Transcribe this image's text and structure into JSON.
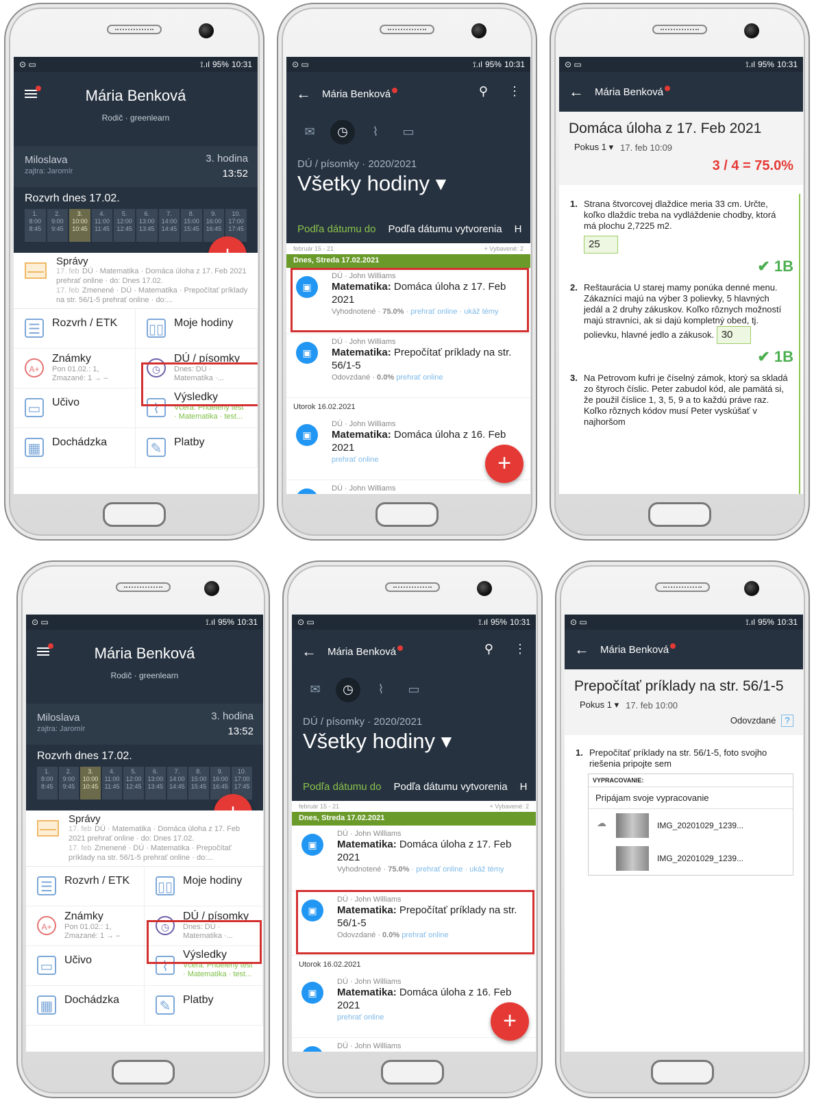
{
  "status_bar": {
    "signal": "⟟.ıl",
    "battery": "95%",
    "time": "10:31"
  },
  "home": {
    "title": "Mária Benková",
    "subtitle": "Rodič · greenlearn",
    "student": "Miloslava",
    "tomorrow": "zajtra: Jaromír",
    "lesson": "3. hodina",
    "lesson_time": "13:52",
    "schedule_title": "Rozvrh dnes 17.02.",
    "periods": [
      {
        "n": "1.",
        "t": "8:00 8:45"
      },
      {
        "n": "2.",
        "t": "9:00 9:45"
      },
      {
        "n": "3.",
        "t": "10:00 10:45"
      },
      {
        "n": "4.",
        "t": "11:00 11:45"
      },
      {
        "n": "5.",
        "t": "12:00 12:45"
      },
      {
        "n": "6.",
        "t": "13:00 13:45"
      },
      {
        "n": "7.",
        "t": "14:00 14:45"
      },
      {
        "n": "8.",
        "t": "15:00 15:45"
      },
      {
        "n": "9.",
        "t": "16:00 16:45"
      },
      {
        "n": "10.",
        "t": "17:00 17:45"
      }
    ],
    "messages": {
      "title": "Správy",
      "d1": "17. feb",
      "m1": "DÚ · Matematika · Domáca úloha z 17. Feb 2021 prehrať online · do: Dnes 17.02.",
      "d2": "17. feb",
      "m2": "Zmenené · DÚ · Matematika · Prepočítať príklady na str. 56/1-5 prehrať online · do:..."
    },
    "tiles": {
      "rozvrh": "Rozvrh / ETK",
      "moje": "Moje hodiny",
      "znamky": "Známky",
      "znamky_s1": "Pon 01.02.: 1,",
      "znamky_s2": "Zmazané: 1 → –",
      "du": "DÚ / písomky",
      "du_s1": "Dnes: DÚ ·",
      "du_s2": "Matematika ·...",
      "ucivo": "Učivo",
      "vysledky": "Výsledky",
      "vys_s1": "Včera: Pridelený test",
      "vys_s2": "· Matematika · test...",
      "dochadzka": "Dochádzka",
      "platby": "Platby"
    },
    "fab": "+"
  },
  "du_list": {
    "title": "Mária Benková",
    "subtitle": "DÚ / písomky · 2020/2021",
    "big": "Všetky hodiny ▾",
    "tab1": "Podľa dátumu do",
    "tab2": "Podľa dátumu vytvorenia",
    "tab3": "H",
    "range": "február 15 - 21",
    "done": "+ Vybavené: 2",
    "today": "Dnes, Streda 17.02.2021",
    "yesterday": "Utorok 16.02.2021",
    "teacher": "DÚ · John Williams",
    "item1_subj": "Matematika:",
    "item1_title": " Domáca úloha z 17. Feb 2021",
    "item1_status": "Vyhodnotené · ",
    "item1_pct": "75.0%",
    "item1_links": " · prehrať online · ukáž témy",
    "item2_subj": "Matematika:",
    "item2_title": " Prepočítať príklady na str. 56/1-5",
    "item2_status": "Odovzdané · ",
    "item2_pct": "0.0%",
    "item2_links": "prehrať online",
    "item3_subj": "Matematika:",
    "item3_title": " Domáca úloha z 16. Feb 2021",
    "item3_links": "prehrať online"
  },
  "detail1": {
    "title": "Domáca úloha z 17. Feb 2021",
    "pokus": "Pokus 1 ▾",
    "date": "17. feb 10:09",
    "score": "3 / 4 = 75.0%",
    "q1": "Strana štvorcovej dlaždice meria 33 cm. Určte, koľko dlaždíc treba na vydláždenie chodby, ktorá má plochu 2,7225 m2.",
    "a1": "25",
    "q2": "Reštaurácia U starej mamy ponúka denné menu. Zákazníci majú na výber 3 polievky, 5 hlavných jedál a 2 druhy zákuskov. Koľko rôznych možností majú stravníci, ak si dajú kompletný obed, tj. polievku, hlavné jedlo a zákusok.",
    "a2": "30",
    "pts": "✔ 1B",
    "q3": "Na Petrovom kufri je číselný zámok, ktorý sa skladá zo štyroch číslic. Peter zabudol kód, ale pamätá si, že použil číslice 1, 3, 5, 9 a to každú práve raz. Koľko rôznych kódov musí Peter vyskúšať v najhoršom"
  },
  "detail2": {
    "title": "Prepočítať príklady na str. 56/1-5",
    "pokus": "Pokus 1 ▾",
    "date": "17. feb 10:00",
    "state": "Odovzdané",
    "help": "?",
    "q1": "Prepočítať príklady na str. 56/1-5, foto svojho riešenia pripojte sem",
    "att_head": "VYPRACOVANIE:",
    "att_text": "Pripájam svoje vypracovanie",
    "file1": "IMG_20201029_1239...",
    "file2": "IMG_20201029_1239..."
  },
  "colors": {
    "dark": "#263240",
    "accent_red": "#e53935",
    "green": "#6a9a2a",
    "highlight": "#d32f2f"
  }
}
